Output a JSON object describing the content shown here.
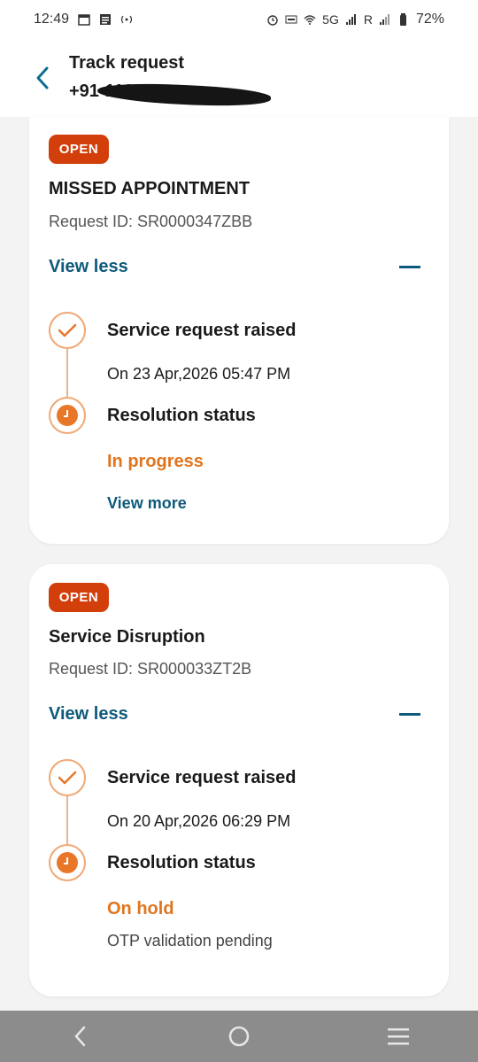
{
  "status_bar": {
    "time": "12:49",
    "network": "5G",
    "roaming": "R",
    "battery": "72%"
  },
  "header": {
    "title": "Track request",
    "phone": "+91-113"
  },
  "requests": [
    {
      "badge": "OPEN",
      "title": "MISSED APPOINTMENT",
      "request_id": "Request ID: SR0000347ZBB",
      "toggle_label": "View less",
      "step1_title": "Service request raised",
      "step1_date": "On 23 Apr,2026 05:47 PM",
      "step2_title": "Resolution status",
      "status": "In progress",
      "link": "View more"
    },
    {
      "badge": "OPEN",
      "title": "Service Disruption",
      "request_id": "Request ID: SR000033ZT2B",
      "toggle_label": "View less",
      "step1_title": "Service request raised",
      "step1_date": "On 20 Apr,2026 06:29 PM",
      "step2_title": "Resolution status",
      "status": "On hold",
      "note": "OTP validation pending"
    }
  ],
  "colors": {
    "badge": "#d23f0b",
    "accent": "#0e5a7a",
    "status": "#e0751f",
    "timeline": "#f0a875"
  },
  "icons": {
    "back": "chevron-left-icon",
    "collapse": "minus-icon",
    "raised": "check-icon",
    "resolution": "clock-icon"
  }
}
